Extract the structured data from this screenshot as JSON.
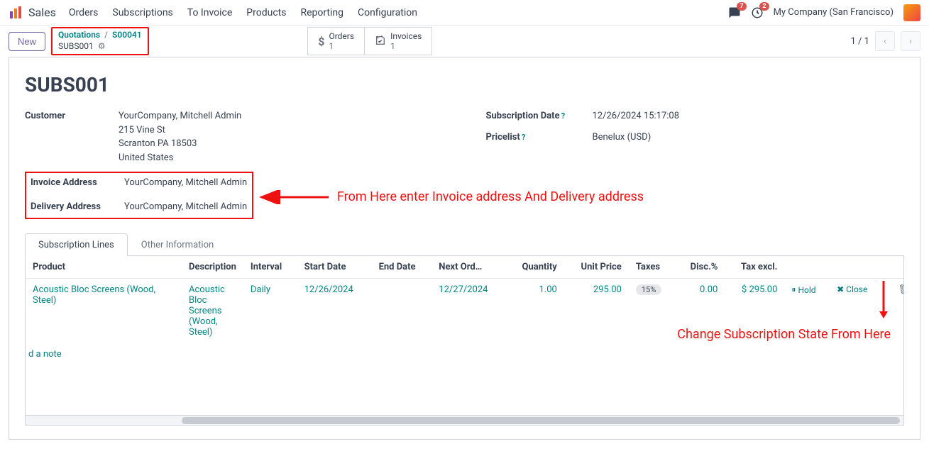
{
  "nav": {
    "brand": "Sales",
    "items": [
      "Orders",
      "Subscriptions",
      "To Invoice",
      "Products",
      "Reporting",
      "Configuration"
    ],
    "msg_badge": "7",
    "activity_badge": "2",
    "company": "My Company (San Francisco)"
  },
  "actionbar": {
    "new_label": "New",
    "crumb1": "Quotations",
    "crumb2": "S00041",
    "record_name": "SUBS001",
    "stat_orders_label": "Orders",
    "stat_orders_n": "1",
    "stat_invoices_label": "Invoices",
    "stat_invoices_n": "1",
    "pager": "1 / 1"
  },
  "form": {
    "title": "SUBS001",
    "customer_label": "Customer",
    "customer_name": "YourCompany, Mitchell Admin",
    "addr1": "215 Vine St",
    "addr2": "Scranton PA 18503",
    "addr3": "United States",
    "inv_label": "Invoice Address",
    "inv_val": "YourCompany, Mitchell Admin",
    "del_label": "Delivery Address",
    "del_val": "YourCompany, Mitchell Admin",
    "subdate_label": "Subscription Date",
    "subdate_val": "12/26/2024 15:17:08",
    "pricelist_label": "Pricelist",
    "pricelist_val": "Benelux (USD)"
  },
  "annotation_top": "From Here enter Invoice address And Delivery address",
  "annotation_bottom": "Change Subscription State From Here",
  "tabs": {
    "t1": "Subscription Lines",
    "t2": "Other Information"
  },
  "table": {
    "h": {
      "product": "Product",
      "desc": "Description",
      "interval": "Interval",
      "start": "Start Date",
      "end": "End Date",
      "next": "Next Ord…",
      "qty": "Quantity",
      "price": "Unit Price",
      "taxes": "Taxes",
      "disc": "Disc.%",
      "taxexcl": "Tax excl."
    },
    "row": {
      "product": "Acoustic Bloc Screens (Wood, Steel)",
      "desc": "Acoustic Bloc Screens (Wood, Steel)",
      "interval": "Daily",
      "start": "12/26/2024",
      "end": "",
      "next": "12/27/2024",
      "qty": "1.00",
      "price": "295.00",
      "taxes": "15%",
      "disc": "0.00",
      "taxexcl": "$ 295.00",
      "hold": "Hold",
      "close": "Close"
    },
    "addnote": "d a note"
  }
}
